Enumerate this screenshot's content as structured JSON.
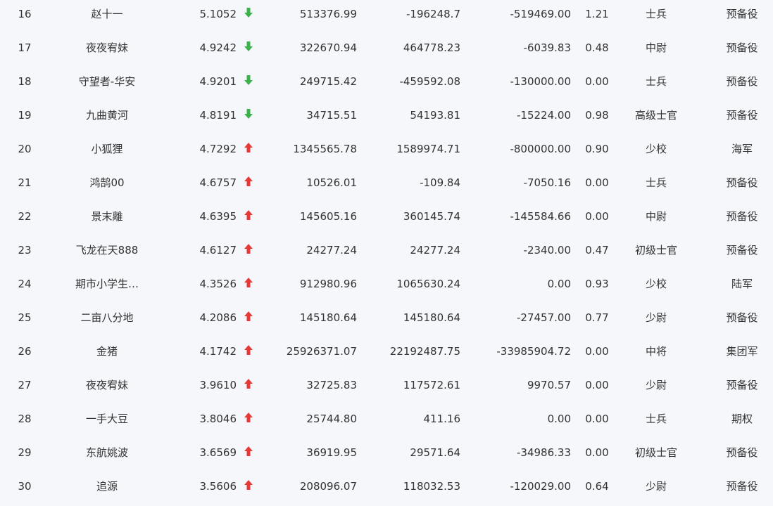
{
  "colors": {
    "up": "#e53935",
    "down": "#3cb34a",
    "text": "#333333",
    "background": "#f6f7fb"
  },
  "rows": [
    {
      "rank": "16",
      "name": "赵十一",
      "score": "5.1052",
      "trend": "down",
      "v1": "513376.99",
      "v2": "-196248.7",
      "v3": "-519469.00",
      "ratio": "1.21",
      "level": "士兵",
      "group": "预备役"
    },
    {
      "rank": "17",
      "name": "夜夜宥妹",
      "score": "4.9242",
      "trend": "down",
      "v1": "322670.94",
      "v2": "464778.23",
      "v3": "-6039.83",
      "ratio": "0.48",
      "level": "中尉",
      "group": "预备役"
    },
    {
      "rank": "18",
      "name": "守望者-华安",
      "score": "4.9201",
      "trend": "down",
      "v1": "249715.42",
      "v2": "-459592.08",
      "v3": "-130000.00",
      "ratio": "0.00",
      "level": "士兵",
      "group": "预备役"
    },
    {
      "rank": "19",
      "name": "九曲黄河",
      "score": "4.8191",
      "trend": "down",
      "v1": "34715.51",
      "v2": "54193.81",
      "v3": "-15224.00",
      "ratio": "0.98",
      "level": "高级士官",
      "group": "预备役"
    },
    {
      "rank": "20",
      "name": "小狐狸",
      "score": "4.7292",
      "trend": "up",
      "v1": "1345565.78",
      "v2": "1589974.71",
      "v3": "-800000.00",
      "ratio": "0.90",
      "level": "少校",
      "group": "海军"
    },
    {
      "rank": "21",
      "name": "鸿鹄00",
      "score": "4.6757",
      "trend": "up",
      "v1": "10526.01",
      "v2": "-109.84",
      "v3": "-7050.16",
      "ratio": "0.00",
      "level": "士兵",
      "group": "预备役"
    },
    {
      "rank": "22",
      "name": "景末離",
      "score": "4.6395",
      "trend": "up",
      "v1": "145605.16",
      "v2": "360145.74",
      "v3": "-145584.66",
      "ratio": "0.00",
      "level": "中尉",
      "group": "预备役"
    },
    {
      "rank": "23",
      "name": "飞龙在天888",
      "score": "4.6127",
      "trend": "up",
      "v1": "24277.24",
      "v2": "24277.24",
      "v3": "-2340.00",
      "ratio": "0.47",
      "level": "初级士官",
      "group": "预备役"
    },
    {
      "rank": "24",
      "name": "期市小学生…",
      "score": "4.3526",
      "trend": "up",
      "v1": "912980.96",
      "v2": "1065630.24",
      "v3": "0.00",
      "ratio": "0.93",
      "level": "少校",
      "group": "陆军"
    },
    {
      "rank": "25",
      "name": "二亩八分地",
      "score": "4.2086",
      "trend": "up",
      "v1": "145180.64",
      "v2": "145180.64",
      "v3": "-27457.00",
      "ratio": "0.77",
      "level": "少尉",
      "group": "预备役"
    },
    {
      "rank": "26",
      "name": "金猪",
      "score": "4.1742",
      "trend": "up",
      "v1": "25926371.07",
      "v2": "22192487.75",
      "v3": "-33985904.72",
      "ratio": "0.00",
      "level": "中将",
      "group": "集团军"
    },
    {
      "rank": "27",
      "name": "夜夜宥妹",
      "score": "3.9610",
      "trend": "up",
      "v1": "32725.83",
      "v2": "117572.61",
      "v3": "9970.57",
      "ratio": "0.00",
      "level": "少尉",
      "group": "预备役"
    },
    {
      "rank": "28",
      "name": "一手大豆",
      "score": "3.8046",
      "trend": "up",
      "v1": "25744.80",
      "v2": "411.16",
      "v3": "0.00",
      "ratio": "0.00",
      "level": "士兵",
      "group": "期权"
    },
    {
      "rank": "29",
      "name": "东航姚波",
      "score": "3.6569",
      "trend": "up",
      "v1": "36919.95",
      "v2": "29571.64",
      "v3": "-34986.33",
      "ratio": "0.00",
      "level": "初级士官",
      "group": "预备役"
    },
    {
      "rank": "30",
      "name": "追源",
      "score": "3.5606",
      "trend": "up",
      "v1": "208096.07",
      "v2": "118032.53",
      "v3": "-120029.00",
      "ratio": "0.64",
      "level": "少尉",
      "group": "预备役"
    }
  ]
}
